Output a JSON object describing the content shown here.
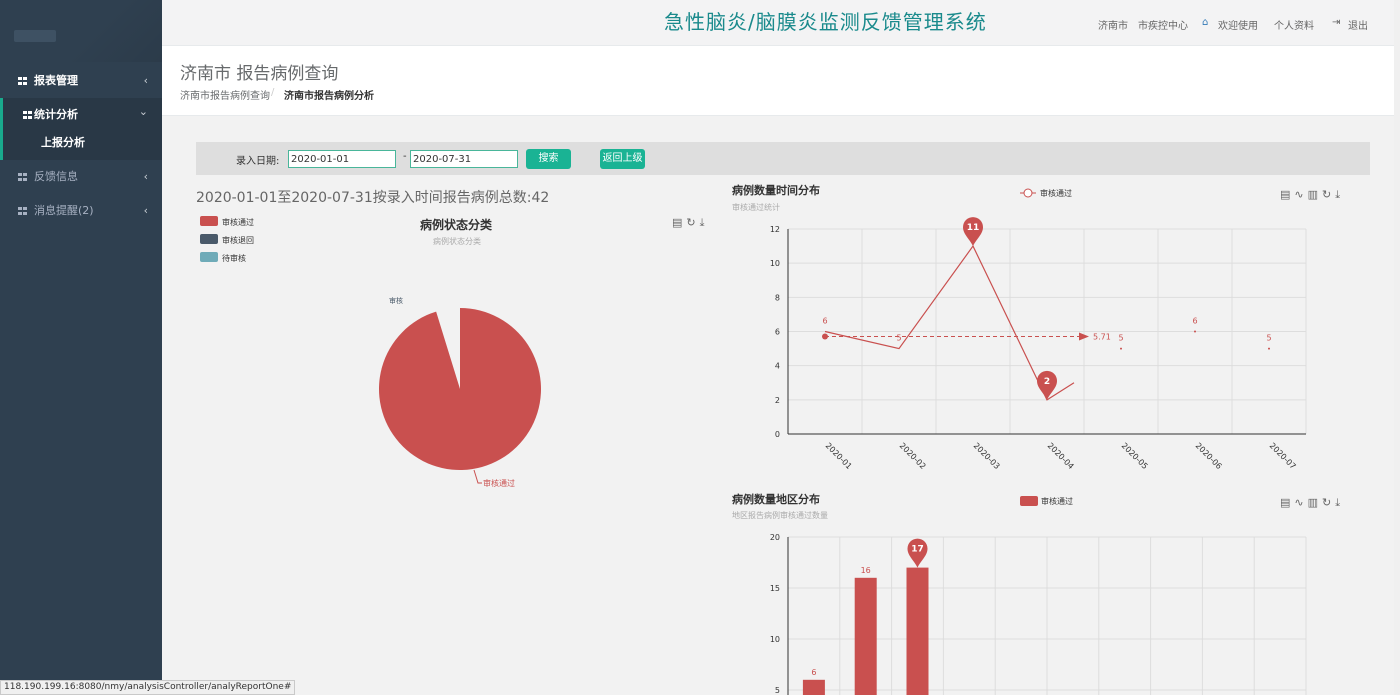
{
  "system_title": "急性脑炎/脑膜炎监测反馈管理系统",
  "topbar": {
    "city": "济南市",
    "org": "市疾控中心",
    "welcome": "欢迎使用",
    "profile": "个人资料",
    "logout": "退出"
  },
  "sidebar": {
    "items": [
      {
        "label": "报表管理",
        "chevron": "‹"
      },
      {
        "label": "统计分析",
        "chevron": "⌄"
      },
      {
        "label": "反馈信息",
        "chevron": "‹"
      },
      {
        "label": "消息提醒(2)",
        "chevron": "‹"
      }
    ],
    "subitems": [
      {
        "label": "上报分析"
      }
    ]
  },
  "page": {
    "title": "济南市 报告病例查询",
    "breadcrumb": [
      "济南市报告病例查询",
      "济南市报告病例分析"
    ],
    "breadcrumb_sep": "/"
  },
  "search": {
    "label": "录入日期:",
    "start": "2020-01-01",
    "end": "2020-07-31",
    "dash": "-",
    "search_btn": "搜索",
    "back_btn": "返回上级"
  },
  "summary": "2020-01-01至2020-07-31按录入时间报告病例总数:42",
  "statusbar": "118.190.199.16:8080/nmy/analysisController/analyReportOne#",
  "colors": {
    "primary_red": "#c9504f",
    "dark_slate": "#4a5a6a",
    "teal": "#6fabb8",
    "accent_green": "#1ab394",
    "sidebar_bg": "#2f4050"
  },
  "chart_data": [
    {
      "type": "pie",
      "title": "病例状态分类",
      "subtitle": "病例状态分类",
      "legend": [
        "审核通过",
        "审核退回",
        "待审核"
      ],
      "slices": [
        {
          "name": "审核通过",
          "value": 40
        },
        {
          "name": "审核退回",
          "value": 2
        }
      ],
      "slice_labels": [
        "审核通过",
        "审核"
      ]
    },
    {
      "type": "line",
      "title": "病例数量时间分布",
      "subtitle": "审核通过统计",
      "legend": [
        "审核通过"
      ],
      "categories": [
        "2020-01",
        "2020-02",
        "2020-03",
        "2020-04",
        "2020-05",
        "2020-06",
        "2020-07"
      ],
      "series": [
        {
          "name": "审核通过",
          "values": [
            6,
            5,
            11,
            2,
            5,
            6,
            5
          ]
        }
      ],
      "ylim": [
        0,
        12
      ],
      "yticks": [
        0,
        2,
        4,
        6,
        8,
        10,
        12
      ],
      "max_marker": 11,
      "min_marker": 2,
      "average": 5.71
    },
    {
      "type": "bar",
      "title": "病例数量地区分布",
      "subtitle": "地区报告病例审核通过数量",
      "legend": [
        "审核通过"
      ],
      "series": [
        {
          "name": "审核通过",
          "values": [
            6,
            16,
            17
          ]
        }
      ],
      "ylim": [
        0,
        20
      ],
      "yticks": [
        5,
        10,
        15,
        20
      ],
      "max_marker": 17
    }
  ]
}
